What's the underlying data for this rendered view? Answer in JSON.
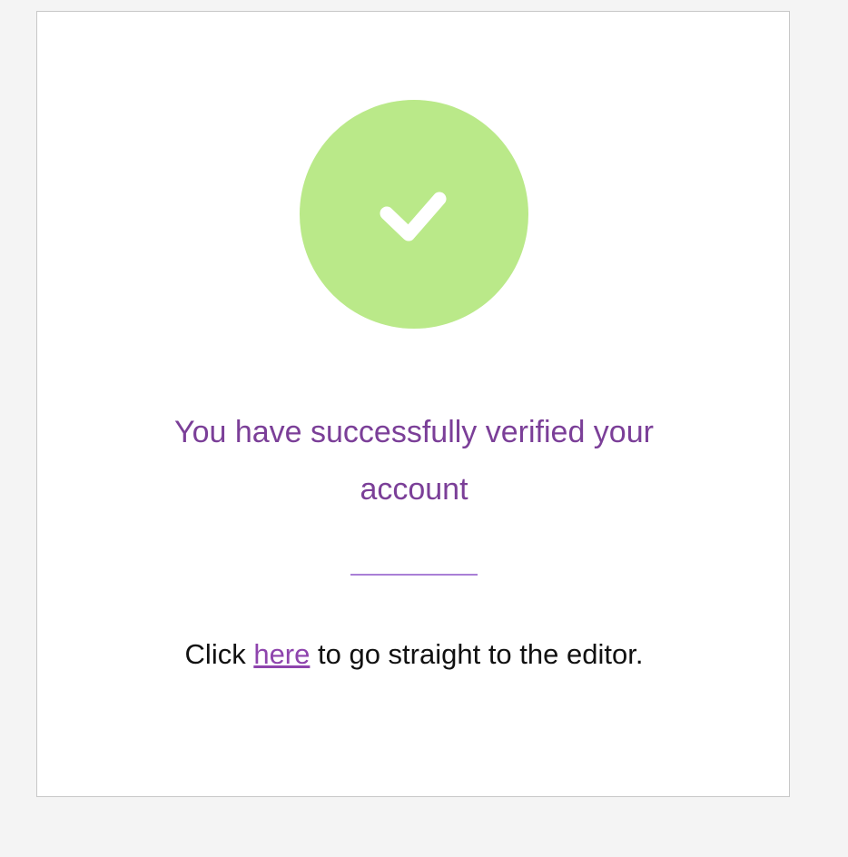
{
  "status": {
    "icon": "checkmark-icon",
    "circle_color": "#bae989",
    "accent_color": "#7b3f98"
  },
  "message": {
    "title": "You have successfully verified your account"
  },
  "instruction": {
    "prefix": "Click ",
    "link_text": "here",
    "suffix": " to go straight to the editor."
  }
}
